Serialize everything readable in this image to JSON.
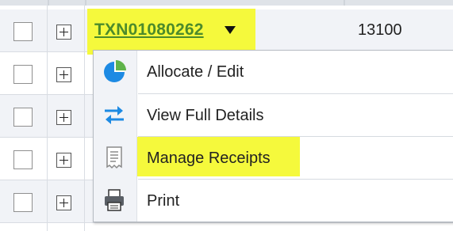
{
  "row": {
    "transaction_id": "TXN01080262",
    "amount": "13100"
  },
  "menu": {
    "items": [
      {
        "label": "Allocate / Edit",
        "icon": "pie-chart-icon"
      },
      {
        "label": "View Full Details",
        "icon": "swap-arrows-icon"
      },
      {
        "label": "Manage Receipts",
        "icon": "receipt-icon",
        "highlighted": true
      },
      {
        "label": "Print",
        "icon": "printer-icon"
      }
    ]
  },
  "colors": {
    "highlight": "#f5f93c",
    "link": "#4c8b2b",
    "row_shade": "#f1f3f7",
    "icon_blue": "#1d8ae3"
  }
}
